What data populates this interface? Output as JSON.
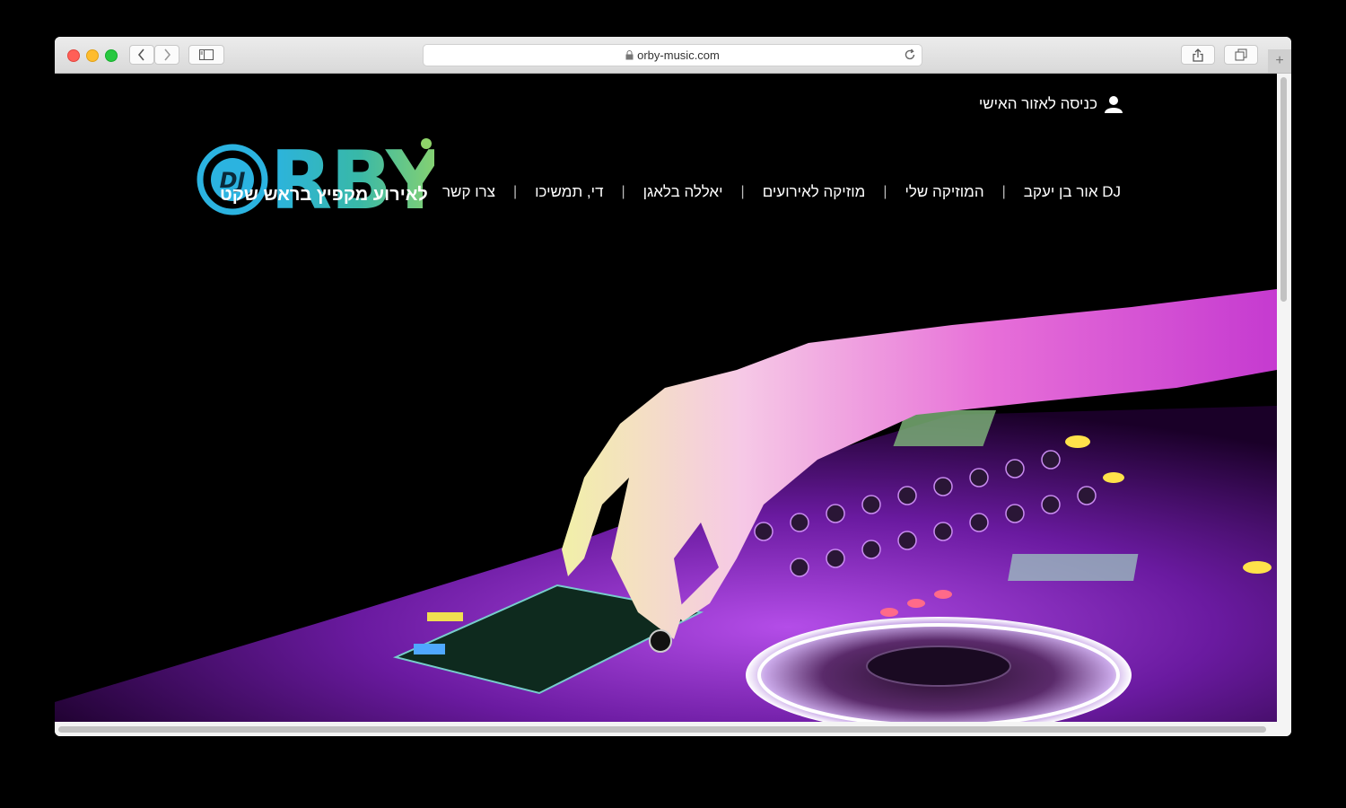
{
  "browser": {
    "url": "orby-music.com"
  },
  "site": {
    "login_label": "כניסה לאזור האישי",
    "logo_text": "DJ ORBY",
    "tagline": "לאירוע מקפיץ בראש שקט",
    "nav": [
      {
        "label": "DJ אור בן יעקב"
      },
      {
        "label": "המוזיקה שלי"
      },
      {
        "label": "מוזיקה לאירועים"
      },
      {
        "label": "יאללה בלאגן"
      },
      {
        "label": "די, תמשיכו"
      },
      {
        "label": "צרו קשר"
      }
    ]
  },
  "colors": {
    "logo_blue": "#2bb3e0",
    "logo_green": "#8fd46a",
    "hero_purple": "#a02de0",
    "hero_pink": "#e86ad8"
  }
}
